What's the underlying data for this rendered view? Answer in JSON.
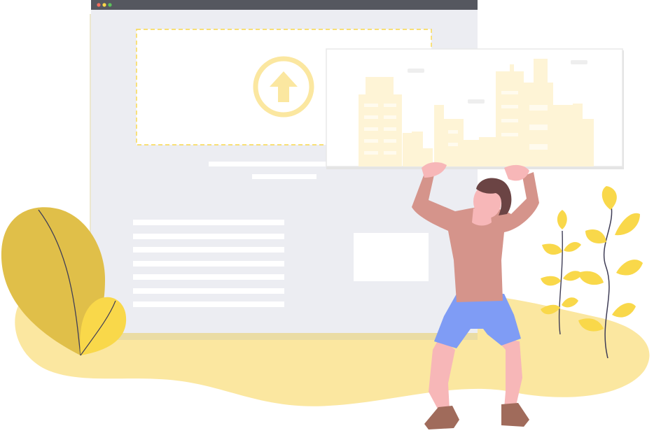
{
  "illustration": {
    "colors": {
      "accent_yellow": "#F9D84A",
      "soft_yellow": "#FBE7A0",
      "leaf_gold": "#E0BF49",
      "browser_bg": "#ECEDF2",
      "browser_bar": "#55575F",
      "shirt": "#D5948B",
      "skin": "#F7B7B8",
      "hair": "#6B4444",
      "shorts": "#7F9CF5",
      "shoes": "#A06B5B"
    },
    "icons": {
      "upload": "upload-arrow-icon"
    }
  }
}
